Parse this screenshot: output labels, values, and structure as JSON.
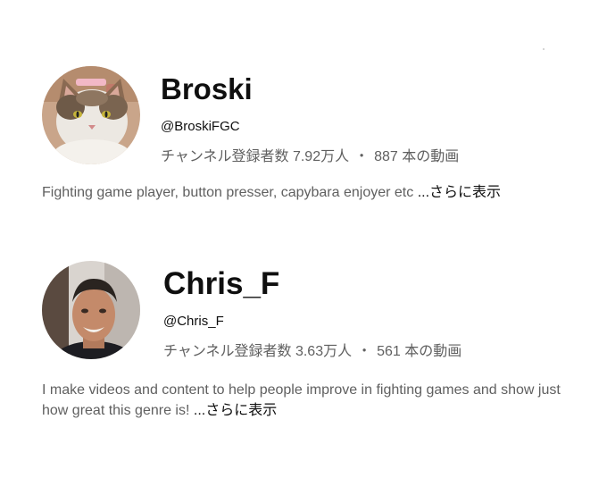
{
  "channels": [
    {
      "name": "Broski",
      "handle": "@BroskiFGC",
      "subscribers": "チャンネル登録者数 7.92万人",
      "separator": "・",
      "videos": "887 本の動画",
      "description": "Fighting game player, button presser, capybara enjoyer etc ",
      "more_label": "...さらに表示",
      "avatar_icon": "cat-photo-avatar"
    },
    {
      "name": "Chris_F",
      "handle": "@Chris_F",
      "subscribers": "チャンネル登録者数 3.63万人",
      "separator": "・",
      "videos": "561 本の動画",
      "description": "I make videos and content to help people improve in fighting games and show just how great this genre is! ",
      "more_label": "...さらに表示",
      "avatar_icon": "person-photo-avatar"
    }
  ]
}
